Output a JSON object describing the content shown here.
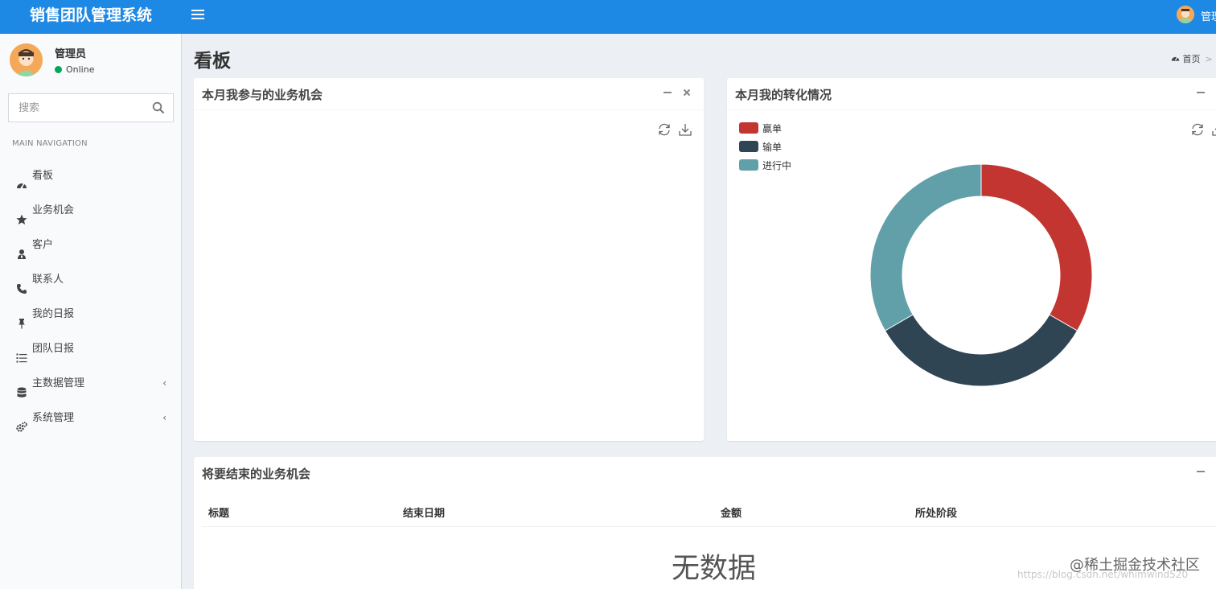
{
  "header": {
    "logo": "销售团队管理系统",
    "user_name": "管理员"
  },
  "sidebar": {
    "user_name": "管理员",
    "status": "Online",
    "search_placeholder": "搜索",
    "nav_header": "MAIN NAVIGATION",
    "items": [
      {
        "label": "看板",
        "icon": "dashboard-icon"
      },
      {
        "label": "业务机会",
        "icon": "star-icon"
      },
      {
        "label": "客户",
        "icon": "user-icon"
      },
      {
        "label": "联系人",
        "icon": "phone-icon"
      },
      {
        "label": "我的日报",
        "icon": "pin-icon"
      },
      {
        "label": "团队日报",
        "icon": "list-icon"
      },
      {
        "label": "主数据管理",
        "icon": "database-icon",
        "caret": "‹"
      },
      {
        "label": "系统管理",
        "icon": "gears-icon",
        "caret": "‹"
      }
    ]
  },
  "page": {
    "title": "看板",
    "breadcrumb_home": "首页",
    "breadcrumb_sep": ">"
  },
  "panels": {
    "opportunities": {
      "title": "本月我参与的业务机会"
    },
    "conversion": {
      "title": "本月我的转化情况"
    },
    "closing": {
      "title": "将要结束的业务机会",
      "columns": [
        "标题",
        "结束日期",
        "金额",
        "所处阶段"
      ],
      "empty_text": "无数据"
    }
  },
  "chart_data": {
    "type": "pie",
    "labels": [
      "赢单",
      "输单",
      "进行中"
    ],
    "values": [
      1,
      1,
      1
    ],
    "colors": [
      "#c23531",
      "#2f4554",
      "#61a0a8"
    ]
  },
  "watermark": {
    "text": "@稀土掘金技术社区",
    "url": "https://blog.csdn.net/whimwind520"
  }
}
